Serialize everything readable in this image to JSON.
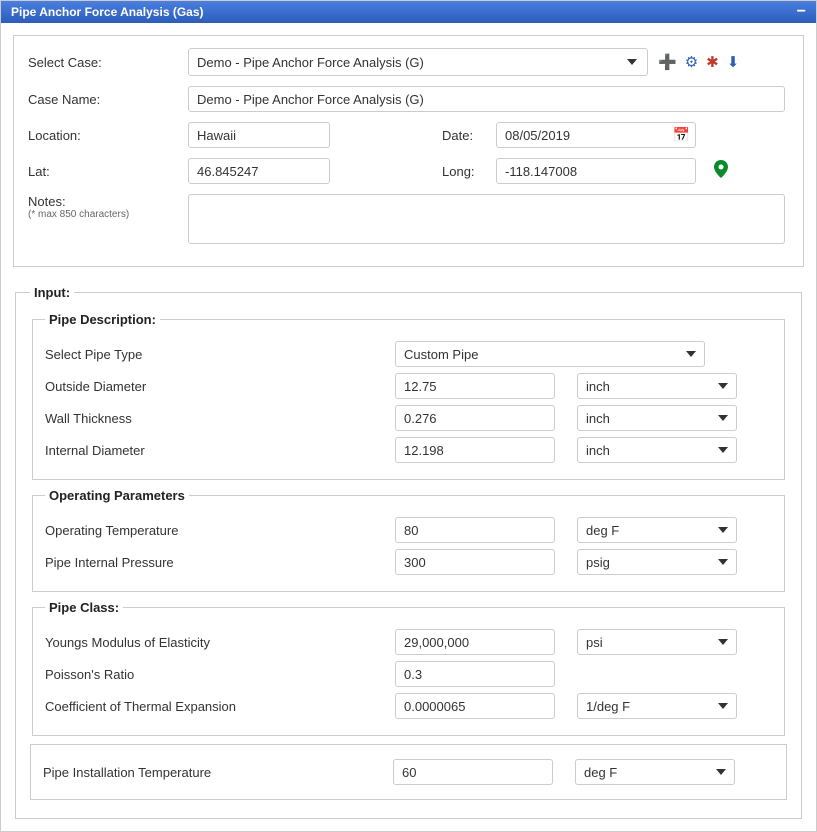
{
  "window": {
    "title": "Pipe Anchor Force Analysis (Gas)"
  },
  "header": {
    "labels": {
      "select_case": "Select Case:",
      "case_name": "Case Name:",
      "location": "Location:",
      "date": "Date:",
      "lat": "Lat:",
      "long": "Long:",
      "notes": "Notes:",
      "notes_hint": "(* max 850 characters)"
    },
    "select_case": "Demo - Pipe Anchor Force Analysis (G)",
    "case_name": "Demo - Pipe Anchor Force Analysis (G)",
    "location": "Hawaii",
    "date": "08/05/2019",
    "lat": "46.845247",
    "long": "-118.147008",
    "notes": ""
  },
  "input": {
    "legend": "Input:",
    "pipe_desc": {
      "legend": "Pipe Description:",
      "rows": {
        "type": {
          "label": "Select Pipe Type",
          "value": "Custom Pipe"
        },
        "od": {
          "label": "Outside Diameter",
          "value": "12.75",
          "unit": "inch"
        },
        "wt": {
          "label": "Wall Thickness",
          "value": "0.276",
          "unit": "inch"
        },
        "id": {
          "label": "Internal Diameter",
          "value": "12.198",
          "unit": "inch"
        }
      }
    },
    "op": {
      "legend": "Operating Parameters",
      "rows": {
        "temp": {
          "label": "Operating Temperature",
          "value": "80",
          "unit": "deg F"
        },
        "press": {
          "label": "Pipe Internal Pressure",
          "value": "300",
          "unit": "psig"
        }
      }
    },
    "class": {
      "legend": "Pipe Class:",
      "rows": {
        "youngs": {
          "label": "Youngs Modulus of Elasticity",
          "value": "29,000,000",
          "unit": "psi"
        },
        "poisson": {
          "label": "Poisson's Ratio",
          "value": "0.3"
        },
        "cte": {
          "label": "Coefficient of Thermal Expansion",
          "value": "0.0000065",
          "unit": "1/deg F"
        }
      }
    },
    "install": {
      "label": "Pipe Installation Temperature",
      "value": "60",
      "unit": "deg F"
    }
  }
}
